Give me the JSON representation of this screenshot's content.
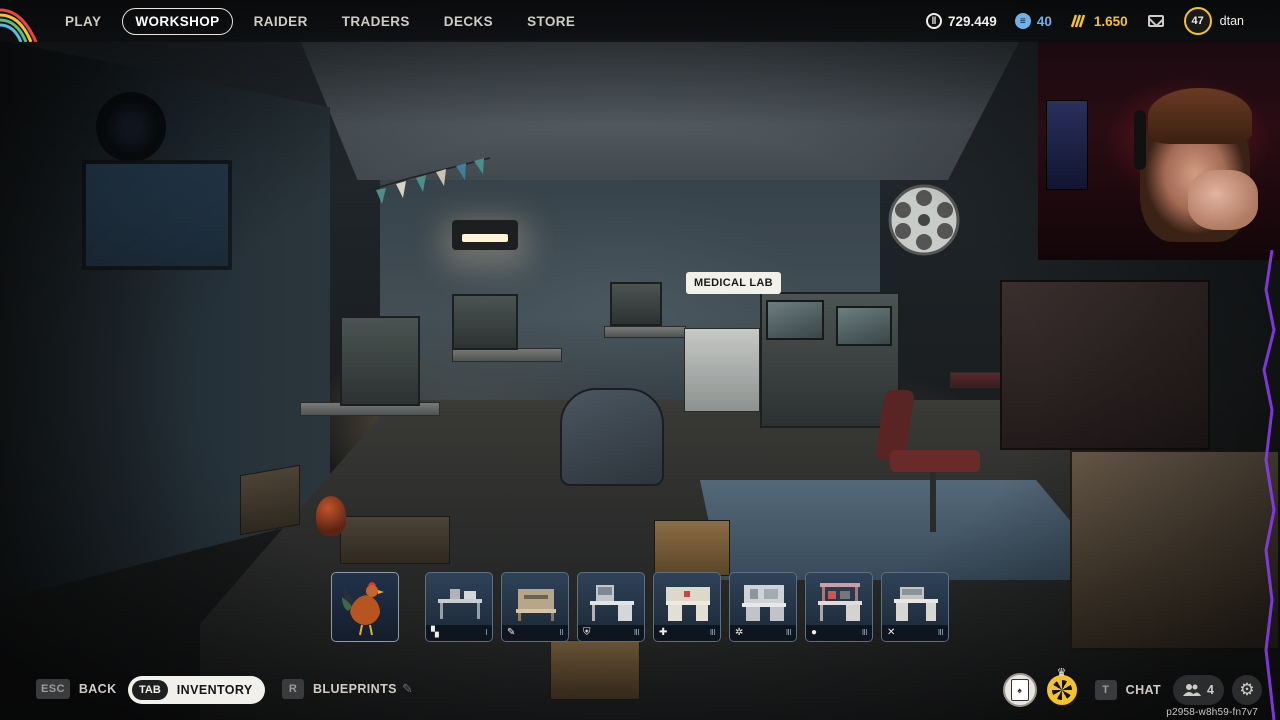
{
  "nav": {
    "items": [
      {
        "label": "PLAY",
        "active": false
      },
      {
        "label": "WORKSHOP",
        "active": true
      },
      {
        "label": "RAIDER",
        "active": false
      },
      {
        "label": "TRADERS",
        "active": false
      },
      {
        "label": "DECKS",
        "active": false
      },
      {
        "label": "STORE",
        "active": false
      }
    ]
  },
  "currencies": {
    "coins": {
      "value": "729.449",
      "icon": "coin-icon"
    },
    "tokens": {
      "value": "40",
      "icon": "token-icon"
    },
    "raider": {
      "value": "1.650",
      "icon": "raider-token-icon"
    }
  },
  "profile": {
    "level": "47",
    "username": "dtan"
  },
  "tooltip": {
    "text": "MEDICAL LAB"
  },
  "item_bar": [
    {
      "name": "rooster",
      "glyph": "",
      "tier": ""
    },
    {
      "name": "workbench",
      "glyph": "▚",
      "tier": "I"
    },
    {
      "name": "gunsmith",
      "glyph": "✎",
      "tier": "II"
    },
    {
      "name": "gear-bench",
      "glyph": "⛨",
      "tier": "III"
    },
    {
      "name": "medical-lab",
      "glyph": "✚",
      "tier": "III"
    },
    {
      "name": "explosives-station",
      "glyph": "✲",
      "tier": "III"
    },
    {
      "name": "utility-station",
      "glyph": "●",
      "tier": "III"
    },
    {
      "name": "refiner",
      "glyph": "✕",
      "tier": "III"
    }
  ],
  "bottom": {
    "back_key": "ESC",
    "back_label": "BACK",
    "inventory_key": "TAB",
    "inventory_label": "INVENTORY",
    "blueprints_key": "R",
    "blueprints_label": "BLUEPRINTS",
    "chat_key": "T",
    "chat_label": "CHAT",
    "party_count": "4",
    "session_id": "p2958-w8h59-fn7v7"
  },
  "colors": {
    "accent_gold": "#f4c22b",
    "token_blue": "#6fb1e8",
    "pill_bg": "#f2f0ea"
  }
}
